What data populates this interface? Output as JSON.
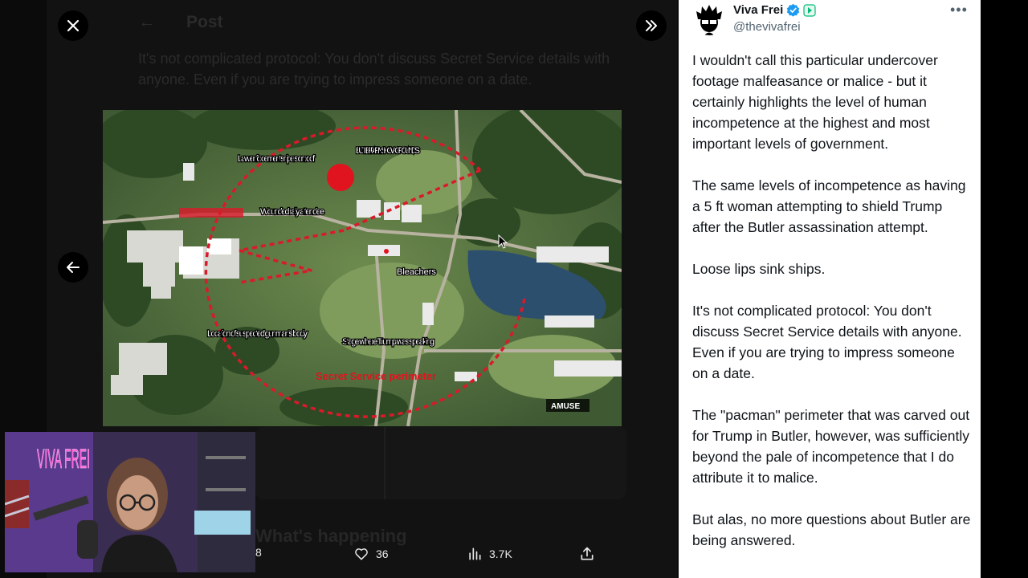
{
  "viewer": {
    "background_post": {
      "title": "Post",
      "text": "It's not complicated protocol: You don't discuss Secret Service details with anyone. Even if you are trying to impress someone on a date.",
      "section_heading": "What's happening"
    },
    "map_labels": {
      "snipers": "Law enforcement snipers on roof",
      "grounds": "BUTLER FARM SHOW GROUNDS",
      "wounded": "Wounded rally attendee",
      "bleachers": "Bleachers",
      "gunman": "Location of suspected gunman's body",
      "stage": "Stage where Trump was speaking",
      "perimeter": "Secret Service perimeter",
      "watermark": "AMUSE"
    },
    "webcam": {
      "sign": "VIVA FREI"
    },
    "actions": {
      "replies": "8",
      "likes": "36",
      "views": "3.7K"
    }
  },
  "tweet": {
    "author_name": "Viva Frei",
    "handle": "@thevivafrei",
    "paragraphs": [
      "I wouldn't call this particular undercover footage malfeasance or malice - but it certainly highlights the level of human incompetence at the highest and most important levels of government.",
      "The same levels of incompetence as having a 5 ft woman attempting to shield Trump after the Butler assassination attempt.",
      "Loose lips sink ships.",
      "It's not complicated protocol: You don't discuss Secret Service details with anyone. Even if you are trying to impress someone on a date.",
      "The \"pacman\" perimeter that was carved out for Trump in Butler, however, was sufficiently beyond the pale of incompetence that I do attribute it to malice.",
      "But alas, no more questions about Butler are being answered."
    ]
  },
  "colors": {
    "verified": "#1d9bf0",
    "badge": "#00ba7c",
    "perimeter": "#d91a2a"
  }
}
